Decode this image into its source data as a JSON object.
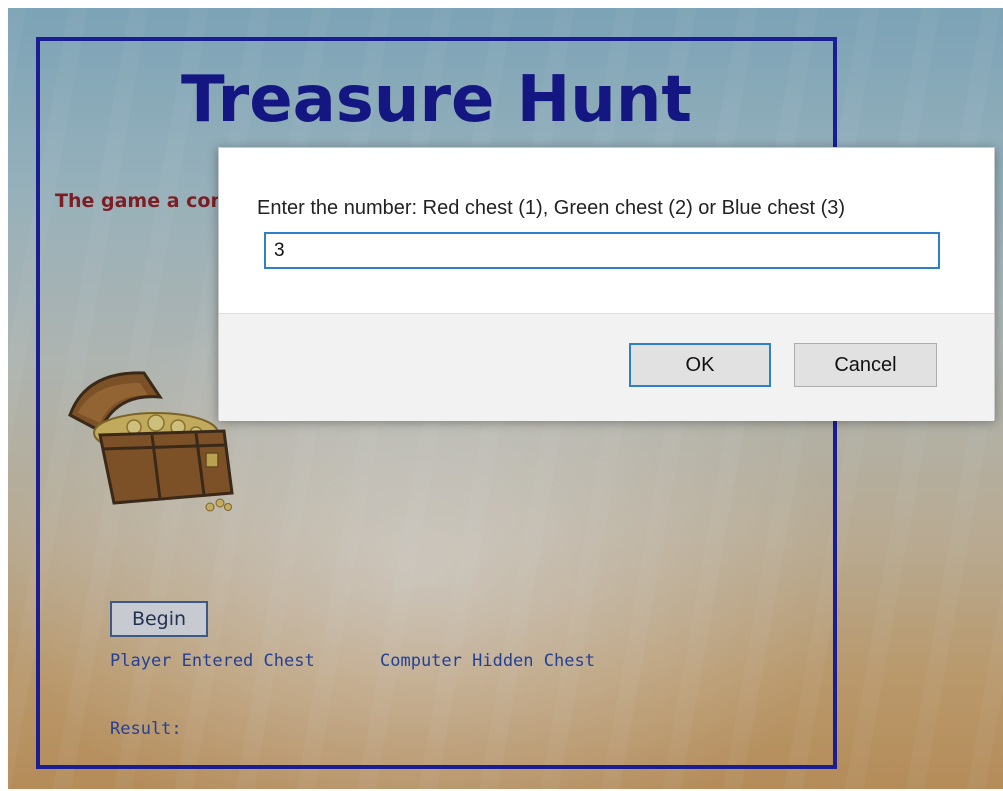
{
  "game": {
    "title": "Treasure Hunt",
    "intro": "The game a contains tre number tha hidden treas",
    "begin_label": "Begin",
    "player_label": "Player Entered Chest",
    "computer_label": "Computer Hidden Chest",
    "result_label": "Result:",
    "chest_image": "treasure-chest-icon"
  },
  "dialog": {
    "message": "Enter the number: Red chest (1), Green chest (2) or Blue chest (3)",
    "input_value": "3",
    "ok_label": "OK",
    "cancel_label": "Cancel"
  },
  "colors": {
    "title": "#0c0c86",
    "intro": "#8a1414",
    "frame_border": "#14149a",
    "labels": "#1e3ea0",
    "focus_accent": "#2e80c8"
  }
}
